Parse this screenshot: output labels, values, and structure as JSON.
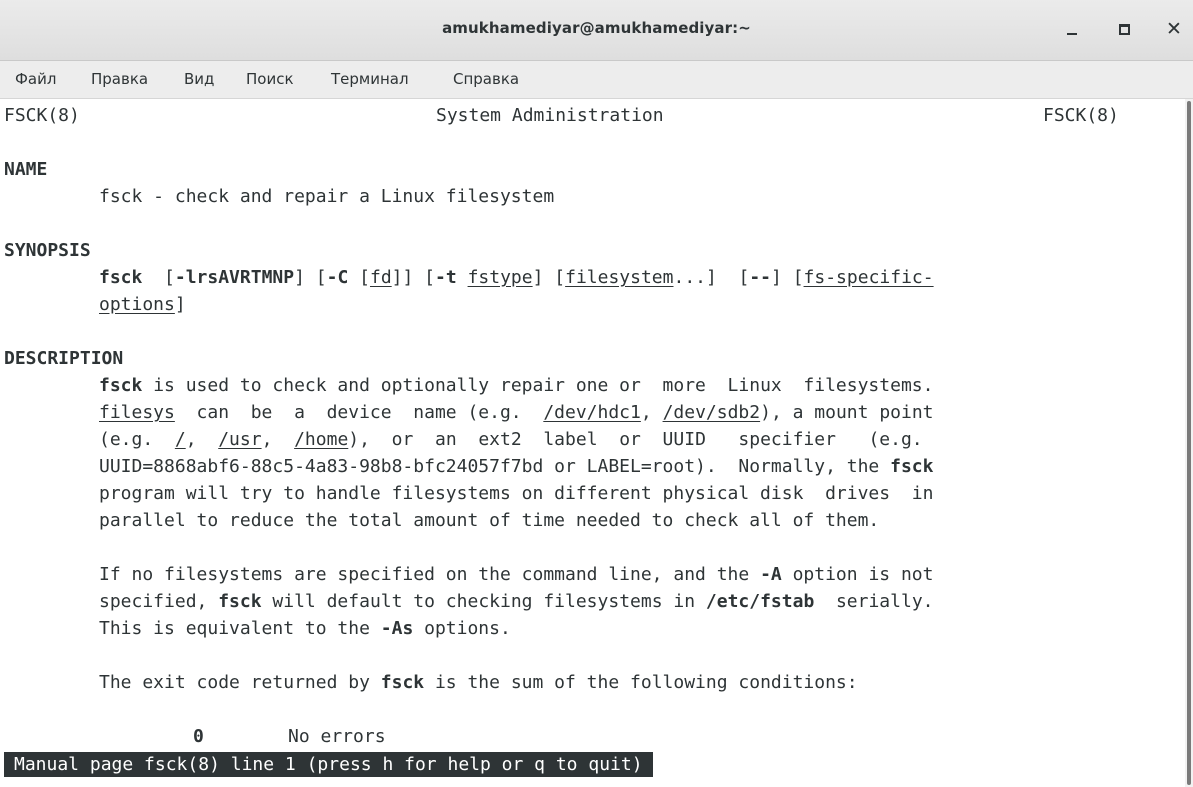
{
  "window": {
    "title": "amukhamediyar@amukhamediyar:~",
    "close_glyph": "✕"
  },
  "menu": [
    "Файл",
    "Правка",
    "Вид",
    "Поиск",
    "Терминал",
    "Справка"
  ],
  "man": {
    "header_left": "FSCK(8)",
    "header_center": "System Administration",
    "header_right": "FSCK(8)",
    "name_heading": "NAME",
    "name_text": "fsck - check and repair a Linux filesystem",
    "synopsis_heading": "SYNOPSIS",
    "syn1": [
      "fsck",
      "  [",
      "-lrsAVRTMNP",
      "] [",
      "-C",
      " [",
      "fd",
      "]] [",
      "-t",
      " ",
      "fstype",
      "] [",
      "filesystem",
      "...]  [",
      "--",
      "] [",
      "fs-specific-"
    ],
    "syn2": [
      "options",
      "]"
    ],
    "description_heading": "DESCRIPTION",
    "d1": [
      "fsck",
      " is used to check and optionally repair one or  more  Linux  filesystems."
    ],
    "d2": [
      "filesys",
      "  can  be  a  device  name (e.g.  ",
      "/dev/hdc1",
      ", ",
      "/dev/sdb2",
      "), a mount point"
    ],
    "d3": [
      "(e.g.  ",
      "/",
      ",  ",
      "/usr",
      ",  ",
      "/home",
      "),  or  an  ext2  label  or  UUID   specifier   (e.g."
    ],
    "d4": [
      "UUID=8868abf6-88c5-4a83-98b8-bfc24057f7bd or LABEL=root).  Normally, the ",
      "fsck"
    ],
    "d5": "program will try to handle filesystems on different physical disk  drives  in",
    "d6": "parallel to reduce the total amount of time needed to check all of them.",
    "p1": [
      "If no filesystems are specified on the command line, and the ",
      "-A",
      " option is not"
    ],
    "p2": [
      "specified, ",
      "fsck",
      " will default to checking filesystems in ",
      "/etc/fstab",
      "  serially."
    ],
    "p3": [
      "This is equivalent to the ",
      "-As",
      " options."
    ],
    "e1": [
      "The exit code returned by ",
      "fsck",
      " is the sum of the following conditions:"
    ],
    "exit0": [
      "0",
      "No errors"
    ],
    "status": "Manual page fsck(8) line 1 (press h for help or q to quit)"
  }
}
